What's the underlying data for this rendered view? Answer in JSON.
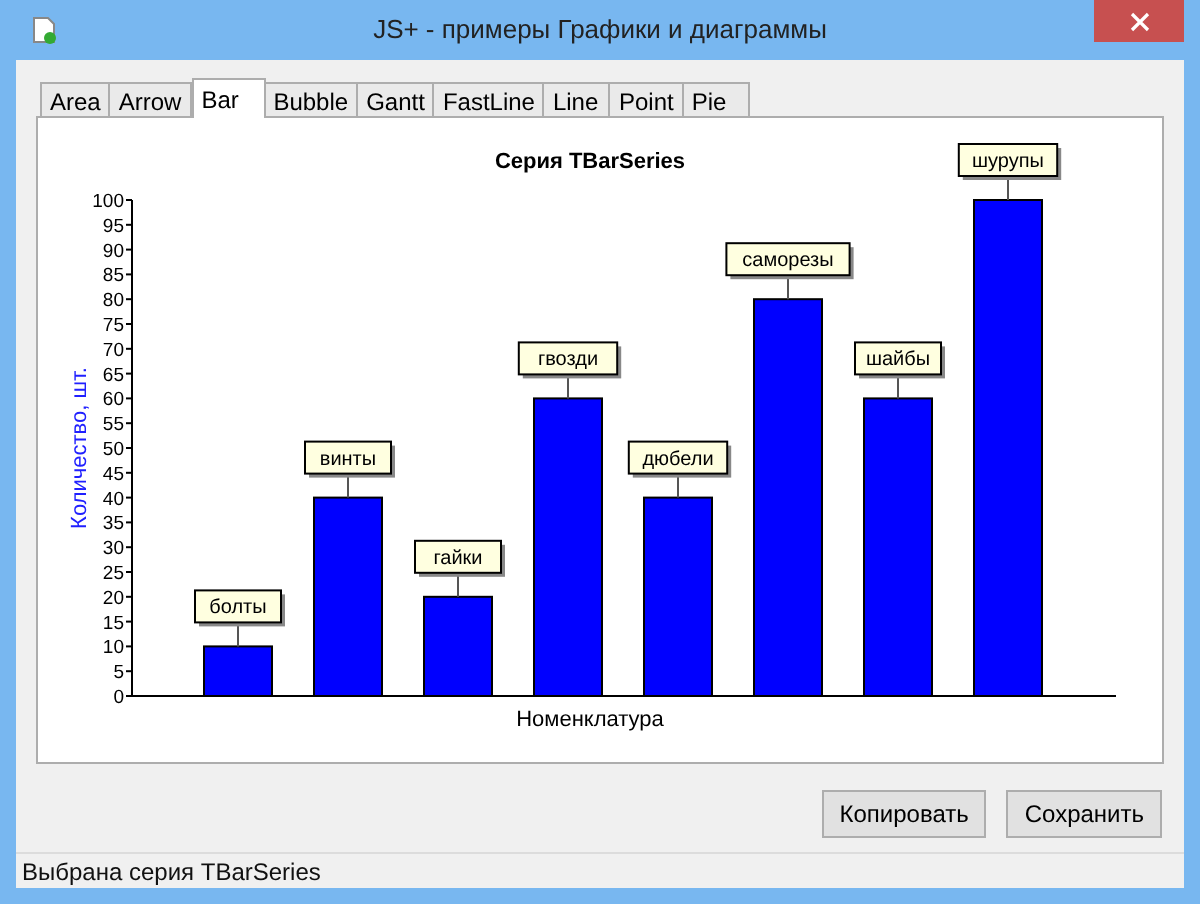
{
  "window": {
    "title": "JS+ - примеры Графики и диаграммы"
  },
  "tabs": [
    {
      "label": "Area",
      "selected": false
    },
    {
      "label": "Arrow",
      "selected": false
    },
    {
      "label": "Bar",
      "selected": true
    },
    {
      "label": "Bubble",
      "selected": false
    },
    {
      "label": "Gantt",
      "selected": false
    },
    {
      "label": "FastLine",
      "selected": false
    },
    {
      "label": "Line",
      "selected": false
    },
    {
      "label": "Point",
      "selected": false
    },
    {
      "label": "Pie",
      "selected": false
    }
  ],
  "chart": {
    "chart_data": {
      "type": "bar",
      "title": "Серия TBarSeries",
      "xlabel": "Номенклатура",
      "ylabel": "Количество, шт.",
      "categories": [
        "болты",
        "винты",
        "гайки",
        "гвозди",
        "дюбели",
        "саморезы",
        "шайбы",
        "шурупы"
      ],
      "series": [
        {
          "color": "#0000ff",
          "values": [
            10,
            40,
            20,
            60,
            40,
            80,
            60,
            100
          ]
        }
      ],
      "ylim": [
        0,
        100
      ],
      "yticks": [
        0,
        5,
        10,
        15,
        20,
        25,
        30,
        35,
        40,
        45,
        50,
        55,
        60,
        65,
        70,
        75,
        80,
        85,
        90,
        95,
        100
      ]
    }
  },
  "buttons": [
    "Копировать",
    "Сохранить"
  ],
  "status_bar": "Выбрана серия TBarSeries"
}
